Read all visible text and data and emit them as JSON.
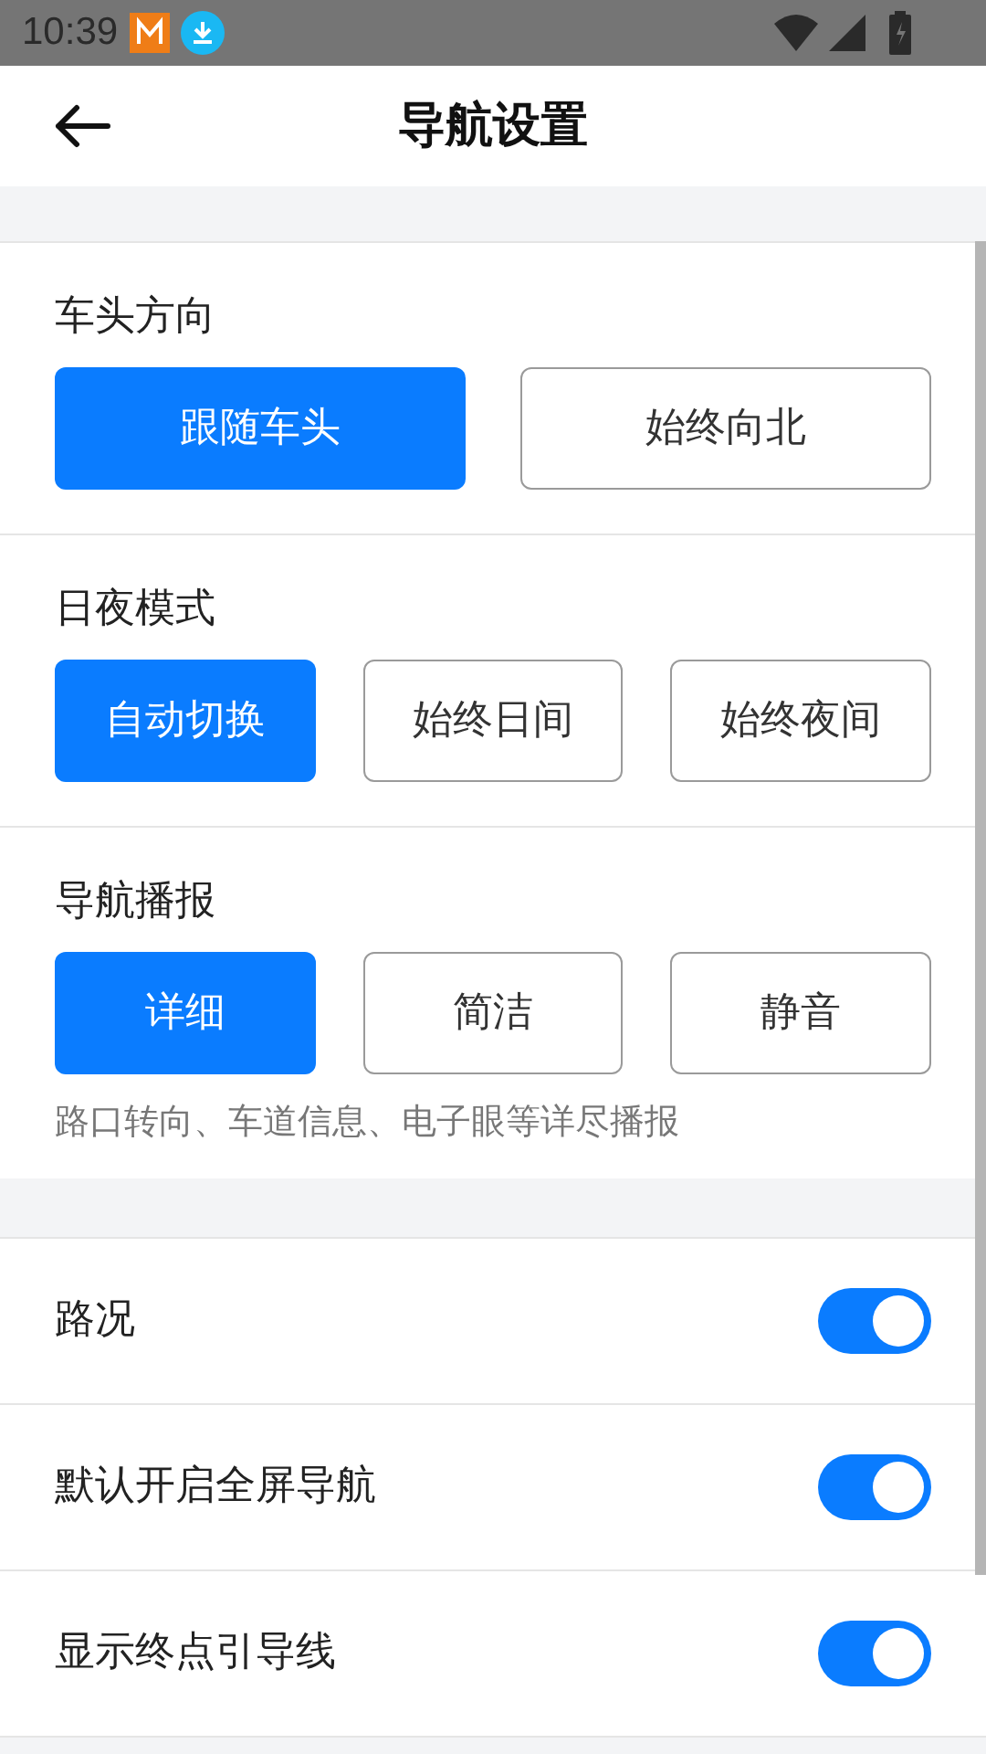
{
  "status_bar": {
    "time": "10:39"
  },
  "header": {
    "title": "导航设置"
  },
  "option_groups": [
    {
      "title": "车头方向",
      "options": [
        {
          "label": "跟随车头",
          "selected": true
        },
        {
          "label": "始终向北",
          "selected": false
        }
      ]
    },
    {
      "title": "日夜模式",
      "options": [
        {
          "label": "自动切换",
          "selected": true
        },
        {
          "label": "始终日间",
          "selected": false
        },
        {
          "label": "始终夜间",
          "selected": false
        }
      ]
    },
    {
      "title": "导航播报",
      "options": [
        {
          "label": "详细",
          "selected": true
        },
        {
          "label": "简洁",
          "selected": false
        },
        {
          "label": "静音",
          "selected": false
        }
      ],
      "hint": "路口转向、车道信息、电子眼等详尽播报"
    }
  ],
  "toggles": [
    {
      "label": "路况",
      "on": true
    },
    {
      "label": "默认开启全屏导航",
      "on": true
    },
    {
      "label": "显示终点引导线",
      "on": true
    }
  ]
}
